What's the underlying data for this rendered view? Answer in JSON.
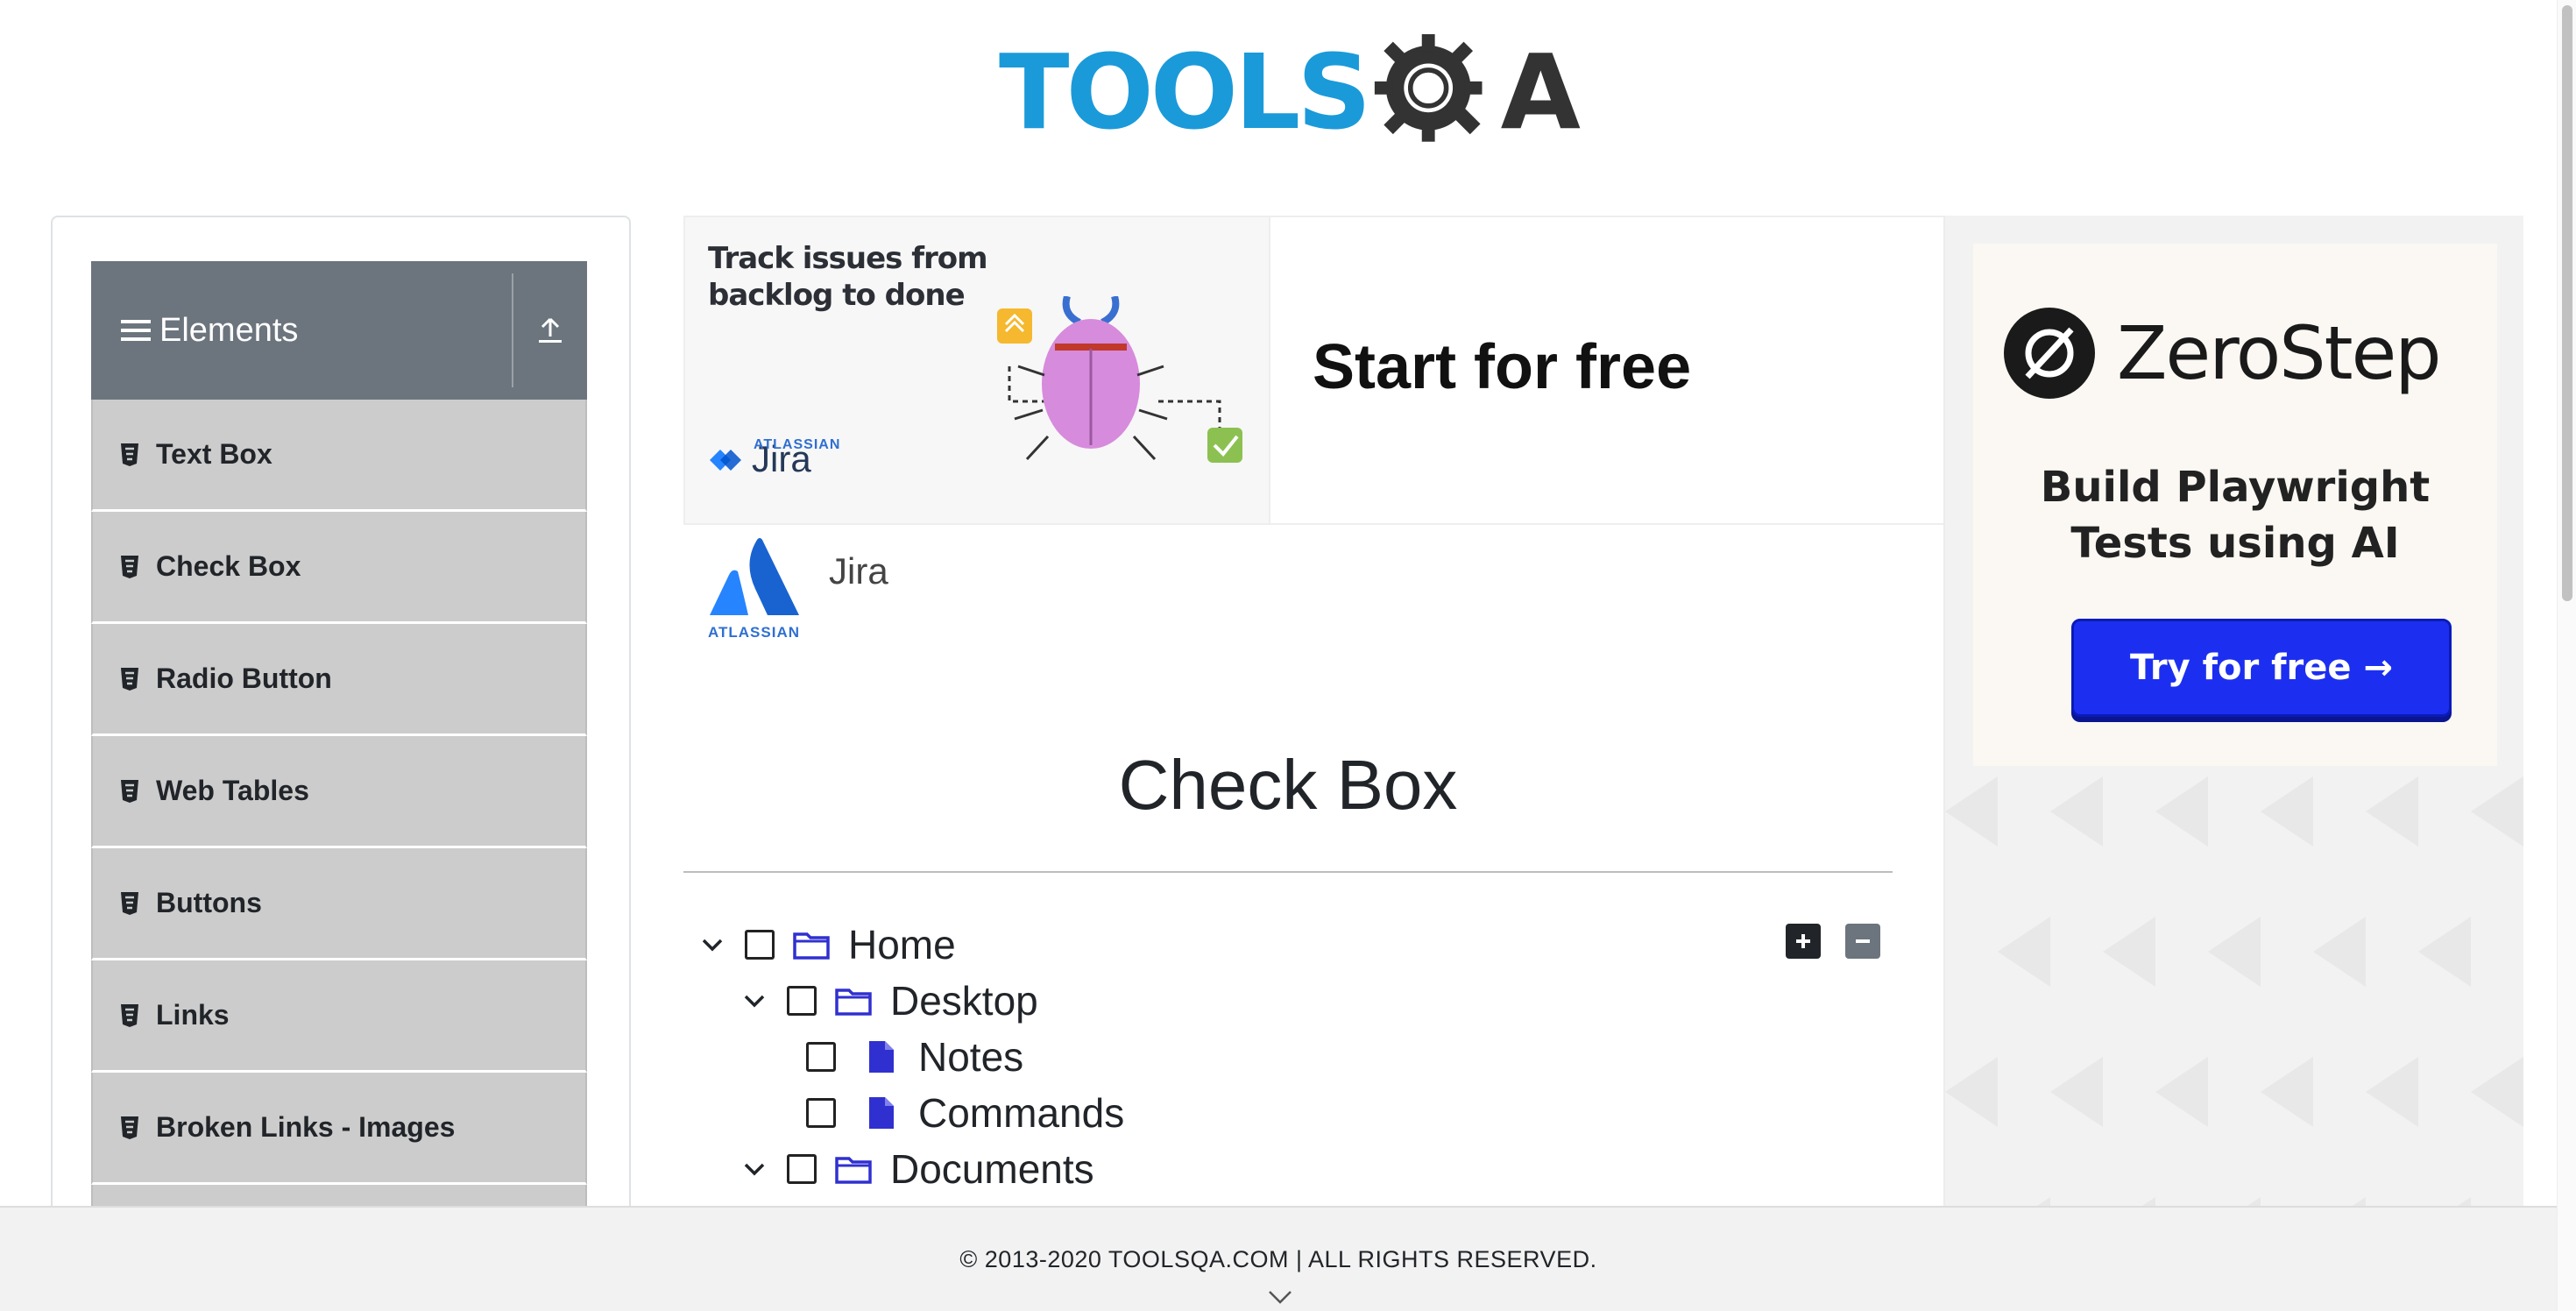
{
  "header": {
    "logo_part1": "TOOLS",
    "logo_part2": "A"
  },
  "sidebar": {
    "group_title": "Elements",
    "items": [
      {
        "label": "Text Box"
      },
      {
        "label": "Check Box"
      },
      {
        "label": "Radio Button"
      },
      {
        "label": "Web Tables"
      },
      {
        "label": "Buttons"
      },
      {
        "label": "Links"
      },
      {
        "label": "Broken Links - Images"
      }
    ]
  },
  "banner": {
    "headline": "Track issues from backlog to done",
    "cta": "Start for free",
    "brand_small": "ATLASSIAN",
    "product_small": "Jira",
    "sponsor_brand": "ATLASSIAN",
    "sponsor_name": "Jira"
  },
  "main": {
    "title": "Check Box",
    "tree": [
      {
        "label": "Home",
        "type": "folder",
        "expanded": true,
        "checked": false
      },
      {
        "label": "Desktop",
        "type": "folder",
        "expanded": true,
        "checked": false
      },
      {
        "label": "Notes",
        "type": "file",
        "checked": false
      },
      {
        "label": "Commands",
        "type": "file",
        "checked": false
      },
      {
        "label": "Documents",
        "type": "folder",
        "expanded": true,
        "checked": false
      }
    ]
  },
  "right_ad": {
    "brand": "ZeroStep",
    "tagline_line1": "Build Playwright",
    "tagline_line2": "Tests using AI",
    "button_label": "Try for free →"
  },
  "footer": {
    "text": "© 2013-2020 TOOLSQA.COM | ALL RIGHTS RESERVED."
  },
  "colors": {
    "logo_blue": "#1b9ad9",
    "sidebar_header": "#6c757d",
    "sidebar_item": "#cccccc",
    "tree_icon": "#3030d0",
    "zerostep_button": "#1c2ff0"
  }
}
